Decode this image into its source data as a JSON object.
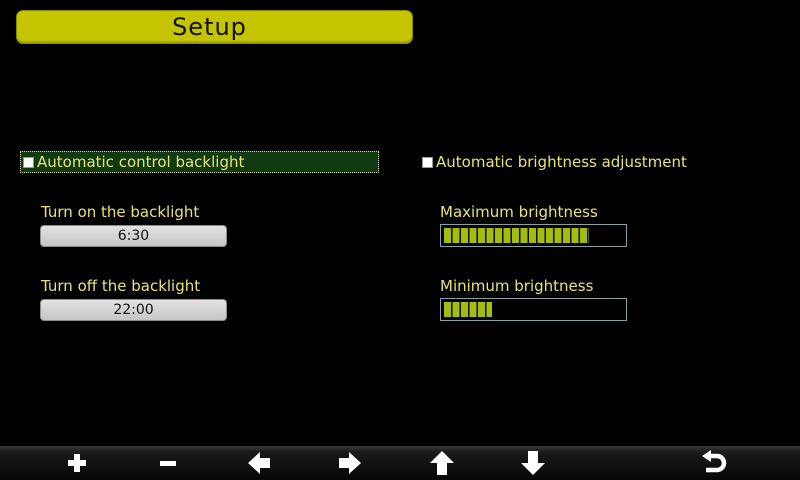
{
  "header": {
    "title": "Setup"
  },
  "backlight": {
    "auto_label": "Automatic control backlight",
    "auto_checked": false,
    "on_label": "Turn on the backlight",
    "on_value": "6:30",
    "off_label": "Turn off the backlight",
    "off_value": "22:00"
  },
  "brightness": {
    "auto_label": "Automatic brightness adjustment",
    "auto_checked": false,
    "max_label": "Maximum brightness",
    "max_level": 0.81,
    "min_label": "Minimum brightness",
    "min_level": 0.27
  },
  "toolbar": {
    "icons": [
      "plus-icon",
      "minus-icon",
      "arrow-left-icon",
      "arrow-right-icon",
      "arrow-up-icon",
      "arrow-down-icon",
      "return-icon"
    ]
  },
  "colors": {
    "title_bar": "#c4c400",
    "label_text": "#e8e27a",
    "level_fill": "#a4bb12",
    "focus_row": "#103a10"
  }
}
